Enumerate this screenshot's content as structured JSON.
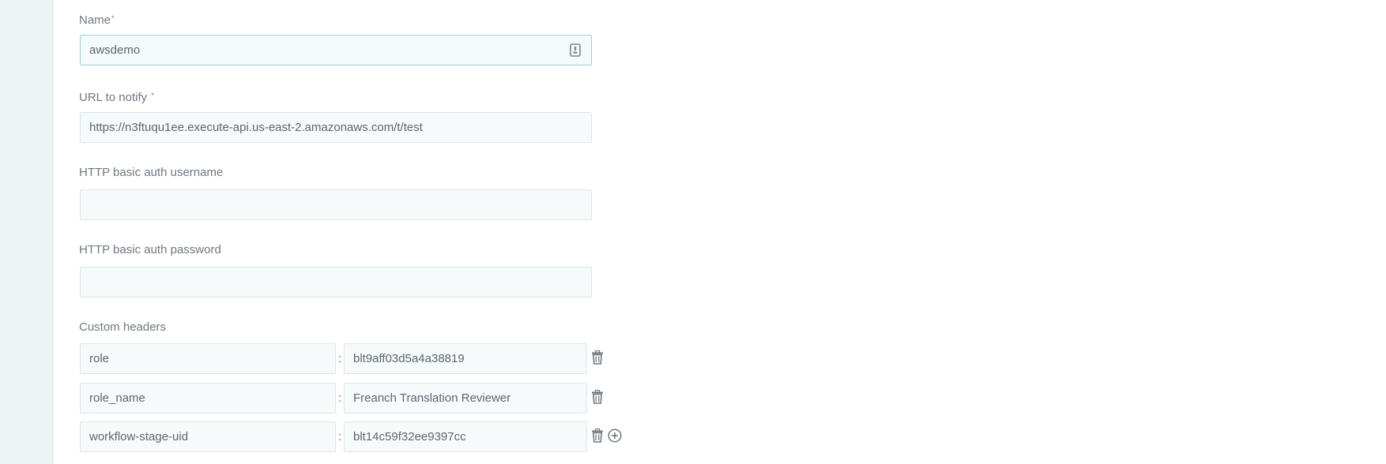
{
  "form": {
    "name": {
      "label": "Name",
      "required_mark": "*",
      "value": "awsdemo"
    },
    "url": {
      "label": "URL to notify",
      "required_mark": "*",
      "value": "https://n3ftuqu1ee.execute-api.us-east-2.amazonaws.com/t/test"
    },
    "auth_username": {
      "label": "HTTP basic auth username",
      "value": ""
    },
    "auth_password": {
      "label": "HTTP basic auth password",
      "value": ""
    },
    "custom_headers": {
      "label": "Custom headers",
      "separator": ":",
      "rows": [
        {
          "key": "role",
          "value": "blt9aff03d5a4a38819"
        },
        {
          "key": "role_name",
          "value": "Freanch Translation Reviewer"
        },
        {
          "key": "workflow-stage-uid",
          "value": "blt14c59f32ee9397cc"
        }
      ]
    }
  },
  "icons": {
    "name_field": "password-manager-icon",
    "remove_row": "trash-icon",
    "add_row": "plus-circle-icon"
  },
  "colors": {
    "field_background": "#f6fafa",
    "field_border": "#dbe6e8",
    "focused_border": "#9fcfe0",
    "label_text": "#6e7781",
    "left_rail": "#edf2f2"
  }
}
